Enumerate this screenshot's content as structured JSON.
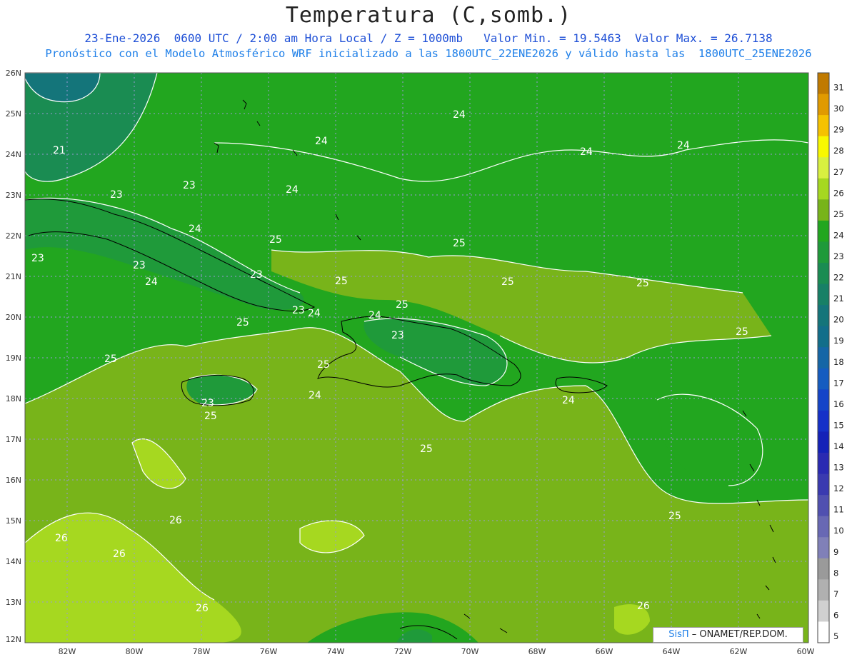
{
  "header": {
    "title": "Temperatura (C,somb.)",
    "line1": "23-Ene-2026  0600 UTC / 2:00 am Hora Local / Z = 1000mb   Valor Min. = 19.5463  Valor Max. = 26.7138",
    "line2": "Pronóstico con el Modelo Atmosférico WRF inicializado a las 1800UTC_22ENE2026 y válido hasta las  1800UTC_25ENE2026"
  },
  "map": {
    "lat_labels": [
      "26N",
      "25N",
      "24N",
      "23N",
      "22N",
      "21N",
      "20N",
      "19N",
      "18N",
      "17N",
      "16N",
      "15N",
      "14N",
      "13N",
      "12N"
    ],
    "lon_labels": [
      "82W",
      "80W",
      "78W",
      "76W",
      "74W",
      "72W",
      "70W",
      "68W",
      "66W",
      "64W",
      "62W",
      "60W"
    ],
    "contour_labels": [
      "21",
      "23",
      "23",
      "23",
      "23",
      "24",
      "24",
      "24",
      "24",
      "24",
      "24",
      "24",
      "25",
      "25",
      "25",
      "25",
      "25",
      "25",
      "25",
      "25",
      "25",
      "25",
      "26",
      "26",
      "26",
      "26",
      "23",
      "23",
      "24",
      "24",
      "24",
      "25",
      "25",
      "24",
      "25",
      "26",
      "23",
      "23"
    ],
    "background_color": "#22a61f"
  },
  "colorbar": {
    "levels": [
      "31",
      "30",
      "29",
      "28",
      "27",
      "26",
      "25",
      "24",
      "23",
      "22",
      "21",
      "20",
      "19",
      "18",
      "17",
      "16",
      "15",
      "14",
      "13",
      "12",
      "11",
      "10",
      "9",
      "8",
      "7",
      "6",
      "5"
    ],
    "colors": [
      "#c07a00",
      "#e09a00",
      "#f5c200",
      "#f8f800",
      "#d8f040",
      "#a6d820",
      "#78b41a",
      "#22a61f",
      "#1f9a3a",
      "#1a8c52",
      "#178066",
      "#14757a",
      "#126e8a",
      "#1566a6",
      "#155cc0",
      "#1444c8",
      "#1530c8",
      "#1422b8",
      "#2a2ab2",
      "#3a3ab0",
      "#5050b0",
      "#6868b4",
      "#8080b8",
      "#9a9a9a",
      "#b0b0b0",
      "#d0d0d0",
      "#ffffff"
    ]
  },
  "credit": {
    "brand": "SisΠ",
    "text": "– ONAMET/REP.DOM."
  }
}
